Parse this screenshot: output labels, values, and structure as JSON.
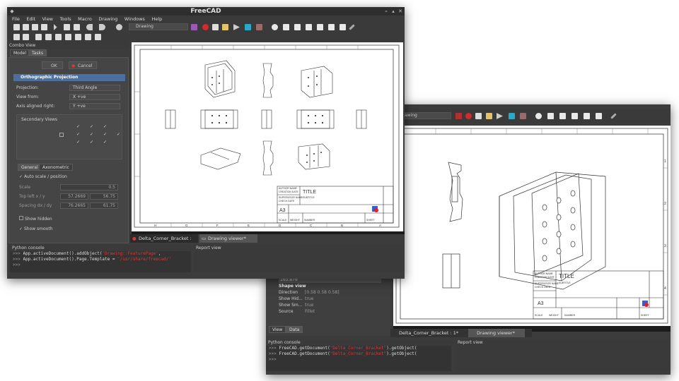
{
  "app": {
    "title": "FreeCAD"
  },
  "menu": [
    "File",
    "Edit",
    "View",
    "Tools",
    "Macro",
    "Drawing",
    "Windows",
    "Help"
  ],
  "toolbar": {
    "workbench": "Drawing",
    "workbench_partial": "awing"
  },
  "combo_view": {
    "title": "Combo View",
    "tabs": [
      "Model",
      "Tasks"
    ],
    "ok_label": "OK",
    "cancel_label": "Cancel",
    "task_title": "Orthographic Projection",
    "fields": [
      {
        "label": "Projection:",
        "value": "Third Angle"
      },
      {
        "label": "View from:",
        "value": "X +ve"
      },
      {
        "label": "Axis aligned right:",
        "value": "Y +ve"
      }
    ],
    "secondary_views_label": "Secondary Views",
    "subtabs": [
      "General",
      "Axonometric"
    ],
    "auto_scale_label": "Auto scale / position",
    "scale": {
      "label": "Scale",
      "value": "0.5"
    },
    "top_left": {
      "label": "Top left x / y",
      "x": "57.2669",
      "y": "56.75"
    },
    "spacing": {
      "label": "Spacing dx / dy",
      "x": "76.2665",
      "y": "61.75"
    },
    "show_hidden_label": "Show hidden",
    "show_smooth_label": "Show smooth"
  },
  "python_console": {
    "title": "Python console",
    "lines": [
      {
        "prefix": ">>> ",
        "code": "App.activeDocument().addObject(",
        "arg": "'Drawing::FeaturePage'",
        "rest": ","
      },
      {
        "prefix": ">>> ",
        "code": "App.activeDocument().Page.Template = ",
        "arg": "'/usr/share/freecad/'",
        "rest": ""
      },
      {
        "prefix": ">>> ",
        "code": "",
        "arg": "",
        "rest": ""
      }
    ]
  },
  "python_console_2": {
    "title": "Python console",
    "lines": [
      {
        "prefix": ">>> ",
        "code": "FreeCAD.getDocument(",
        "arg": "\"Delta_Corner_Bracket\"",
        "rest": ").getObject("
      },
      {
        "prefix": ">>> ",
        "code": "FreeCAD.getDocument(",
        "arg": "\"Delta_Corner_Bracket\"",
        "rest": ").getObject("
      },
      {
        "prefix": ">>> ",
        "code": "",
        "arg": "",
        "rest": ""
      }
    ]
  },
  "report_view": {
    "title": "Report view"
  },
  "doc_tabs": [
    "Delta_Corner_Bracket : 1*",
    "Drawing viewer*"
  ],
  "sheet": {
    "fields": [
      "AUTHOR NAME",
      "CREATION DATE",
      "SUPERVISOR NAME",
      "CHECK DATE"
    ],
    "title": "TITLE",
    "subtitle": "SUBTITLE",
    "size": "A3",
    "scale": "SCALE",
    "weight": "WEIGHT",
    "number": "NUMBER",
    "sheet_label": "SHEET",
    "col_letters": [
      "H",
      "G",
      "F",
      "E",
      "D",
      "C",
      "B",
      "A"
    ],
    "row_numbers": [
      "1",
      "2",
      "3",
      "4"
    ]
  },
  "properties": {
    "group": "Shape view",
    "value_partial": "165.876",
    "rows": [
      {
        "name": "Direction",
        "value": "[0.58 0.58 0.58]"
      },
      {
        "name": "Show Hid...",
        "value": "true"
      },
      {
        "name": "Show Sm...",
        "value": "true"
      },
      {
        "name": "Source",
        "value": "Fillet"
      }
    ],
    "tabs": [
      "View",
      "Data"
    ]
  },
  "colors": {
    "task_header": "#4c6f9e",
    "console_arg": "#d43a3a",
    "window_bg": "#3c3c3c"
  }
}
